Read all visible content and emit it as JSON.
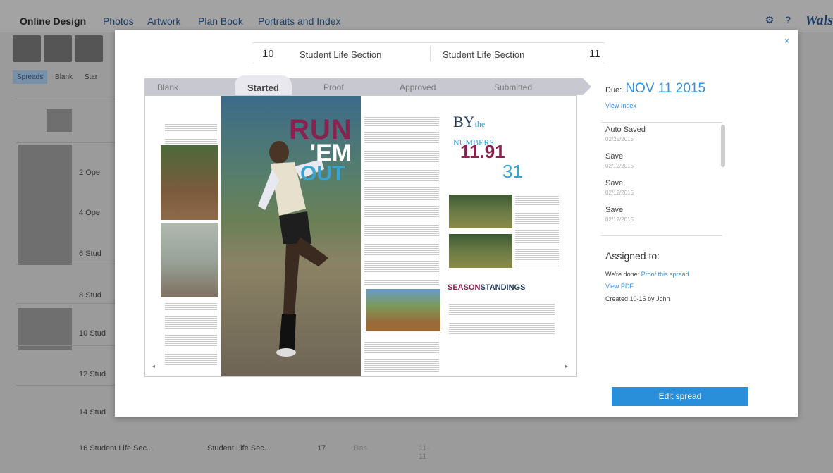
{
  "app": {
    "brand": "Online Design",
    "nav": [
      "Photos",
      "Artwork",
      "Plan Book",
      "Portraits and Index"
    ],
    "logo": "Wals",
    "subtabs": [
      "Spreads",
      "Blank",
      "Star"
    ]
  },
  "background_rows": [
    {
      "num": "2",
      "label": "Ope"
    },
    {
      "num": "4",
      "label": "Ope"
    },
    {
      "num": "6",
      "label": "Stud"
    },
    {
      "num": "8",
      "label": "Stud"
    },
    {
      "num": "10",
      "label": "Stud"
    },
    {
      "num": "12",
      "label": "Stud"
    },
    {
      "num": "14",
      "label": "Stud"
    }
  ],
  "bottom_row": {
    "left_num": "16",
    "left_label": "Student Life Sec...",
    "right_label": "Student Life Sec...",
    "right_num": "17",
    "status": "Bas",
    "date": "11-11"
  },
  "modal": {
    "close": "×",
    "left_page_num": "10",
    "left_page_name": "Student Life Section",
    "right_page_name": "Student Life Section",
    "right_page_num": "11",
    "workflow": [
      "Blank",
      "Started",
      "Proof",
      "Approved",
      "Submitted"
    ],
    "active_step": "Started",
    "spread": {
      "run": "RUN",
      "em": "'EM",
      "out": "OUT",
      "by": "BY",
      "the": "the",
      "numbers": "NUMBERS",
      "big1": "11.91",
      "big2": "31",
      "season": "SEASON",
      "standings": "STANDINGS"
    },
    "due_label": "Due:",
    "due_date": "NOV 11 2015",
    "view_index": "View Index",
    "history": [
      {
        "action": "Auto Saved",
        "date": "02/25/2015"
      },
      {
        "action": "Save",
        "date": "02/12/2015"
      },
      {
        "action": "Save",
        "date": "02/12/2015"
      },
      {
        "action": "Save",
        "date": "02/12/2015"
      }
    ],
    "assigned_to": "Assigned to:",
    "proof_prefix": "We're done:",
    "proof_link": "Proof this spread",
    "view_pdf": "View PDF",
    "created": "Created 10-15 by John",
    "edit_button": "Edit spread"
  }
}
